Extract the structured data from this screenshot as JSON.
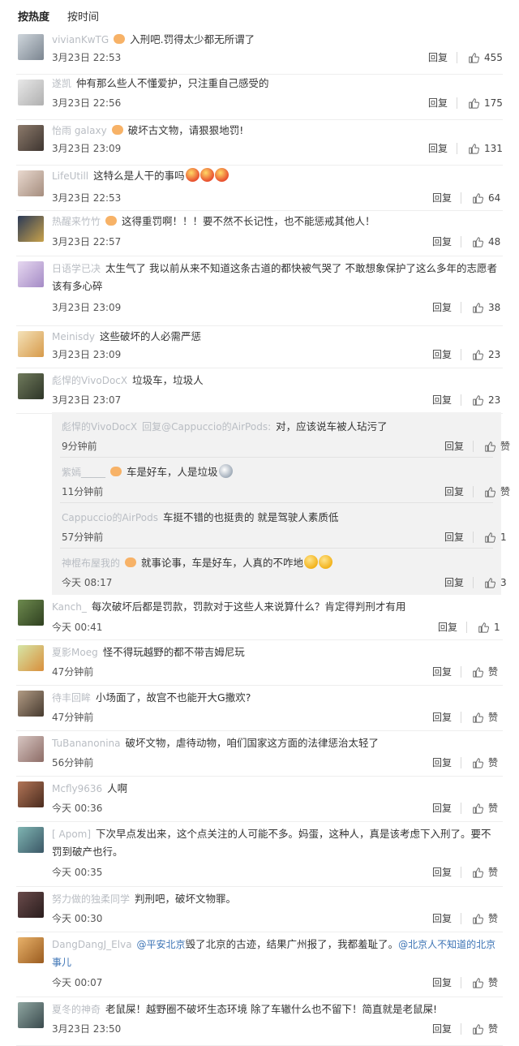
{
  "tabs": [
    "按热度",
    "按时间"
  ],
  "reply_label": "回复",
  "comments": [
    {
      "user": "vivianKwTG",
      "vip": true,
      "text": "入刑吧.罚得太少都无所谓了",
      "time": "3月23日 22:53",
      "likes": "455",
      "av": [
        "#cfd6dc",
        "#7b8590"
      ]
    },
    {
      "user": "遂凯",
      "vip": false,
      "text": "仲有那么些人不懂爱护，只注重自己感受的",
      "time": "3月23日 22:56",
      "likes": "175",
      "av": [
        "#e8e8e8",
        "#b0b0b0"
      ]
    },
    {
      "user": "怡雨 galaxy",
      "vip": true,
      "text": "破坏古文物，请狠狠地罚!",
      "time": "3月23日 23:09",
      "likes": "131",
      "av": [
        "#8c7a6b",
        "#3e3530"
      ]
    },
    {
      "user": "LifeUtill",
      "vip": false,
      "text": "这特么是人干的事吗",
      "emoji": [
        "angry",
        "angry",
        "angry"
      ],
      "time": "3月23日 22:53",
      "likes": "64",
      "av": [
        "#e9d9cf",
        "#a58d7e"
      ]
    },
    {
      "user": "热醒来竹竹",
      "vip": true,
      "text": "这得重罚啊！！！要不然不长记性，也不能惩戒其他人！",
      "time": "3月23日 22:57",
      "likes": "48",
      "av": [
        "#2b3a57",
        "#c8a24b"
      ]
    },
    {
      "user": "日语学已决",
      "vip": false,
      "text": "太生气了 我以前从来不知道这条古道的都快被气哭了 不敢想象保护了这么多年的志愿者该有多心碎",
      "time": "3月23日 23:09",
      "likes": "38",
      "av": [
        "#e6d8f0",
        "#a58bc6"
      ]
    },
    {
      "user": "Meinisdy",
      "vip": false,
      "text": "这些破坏的人必需严惩",
      "time": "3月23日 23:09",
      "likes": "23",
      "av": [
        "#f4e2b9",
        "#d79a4a"
      ]
    },
    {
      "user": "彪悍的VivoDocX",
      "vip": false,
      "text": "垃圾车，垃圾人",
      "time": "3月23日 23:07",
      "likes": "23",
      "av": [
        "#6f7a5c",
        "#2e3527"
      ]
    }
  ],
  "sub_comments": [
    {
      "user": "彪悍的VivoDocX",
      "vip": false,
      "text": "回复@Cappuccio的AirPods:",
      "text2": "对，应该说车被人玷污了",
      "time": "9分钟前",
      "likes": "赞"
    },
    {
      "user": "紫嫣_____",
      "vip": true,
      "text": "车是好车，人是垃圾",
      "emoji": [
        "shock"
      ],
      "time": "11分钟前",
      "likes": "赞"
    },
    {
      "user": "Cappuccio的AirPods",
      "vip": false,
      "text": "车挺不错的也挺贵的 就是驾驶人素质低",
      "time": "57分钟前",
      "likes": "1"
    },
    {
      "user": "神棍布屋我的",
      "vip": true,
      "text": "就事论事，车是好车，人真的不咋地",
      "emoji": [
        "cry",
        "cry"
      ],
      "time": "今天 08:17",
      "likes": "3"
    }
  ],
  "comments2": [
    {
      "user": "Kanch_",
      "vip": false,
      "text": "每次破坏后都是罚款，罚款对于这些人来说算什么？肯定得判刑才有用",
      "time": "今天 00:41",
      "likes": "1",
      "av": [
        "#6d8a4e",
        "#2f4020"
      ]
    },
    {
      "user": "夏影Moeg",
      "vip": false,
      "text": "怪不得玩越野的都不带吉姆尼玩",
      "time": "47分钟前",
      "likes": "赞",
      "av": [
        "#d6e6a7",
        "#d98f3c"
      ]
    },
    {
      "user": "待丰回眸",
      "vip": false,
      "text": "小场面了，故宫不也能开大G撒欢?",
      "time": "47分钟前",
      "likes": "赞",
      "av": [
        "#b29b84",
        "#463a2f"
      ]
    },
    {
      "user": "TuBananonina",
      "vip": false,
      "text": "破坏文物，虐待动物，咱们国家这方面的法律惩治太轻了",
      "time": "56分钟前",
      "likes": "赞",
      "av": [
        "#d7c6c2",
        "#8d6c66"
      ]
    },
    {
      "user": "Mcfly9636",
      "vip": false,
      "text": "人啊",
      "time": "今天 00:36",
      "likes": "赞",
      "av": [
        "#b27557",
        "#4a2b1e"
      ]
    },
    {
      "user": "[ Apom]",
      "vip": false,
      "text": "下次早点发出来，这个点关注的人可能不多。妈蛋，这种人，真是该考虑下入刑了。要不罚到破产也行。",
      "time": "今天 00:35",
      "likes": "赞",
      "av": [
        "#7fb5b2",
        "#3b5766"
      ]
    },
    {
      "user": "努力做的独柔同学",
      "vip": false,
      "text": "判刑吧，破坏文物罪。",
      "time": "今天 00:30",
      "likes": "赞",
      "av": [
        "#6a4b4b",
        "#2a1d1d"
      ]
    },
    {
      "user": "DangDangJ_Elva",
      "vip": false,
      "at1": "@平安北京",
      "text": "毁了北京的古迹，结果广州报了，我都羞耻了。",
      "at2": "@北京人不知道的北京事儿",
      "time": "今天 00:07",
      "likes": "赞",
      "av": [
        "#e8b26a",
        "#9a5b1f"
      ]
    },
    {
      "user": "夏冬的神奇",
      "vip": false,
      "text": "老鼠屎！越野圈不破坏生态环境 除了车辙什么也不留下！简直就是老鼠屎!",
      "time": "3月23日 23:50",
      "likes": "赞",
      "av": [
        "#8fa6a1",
        "#3a4a4d"
      ]
    }
  ]
}
